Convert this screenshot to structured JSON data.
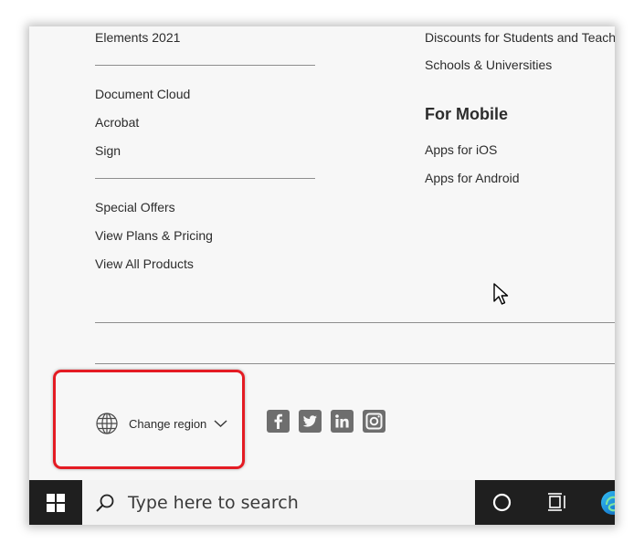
{
  "footer": {
    "left_column": {
      "group_1": [
        "Elements 2021"
      ],
      "group_2": [
        "Document Cloud",
        "Acrobat",
        "Sign"
      ],
      "group_3": [
        "Special Offers",
        "View Plans & Pricing",
        "View All Products"
      ]
    },
    "right_column": {
      "links_top": [
        "Discounts for Students and Teachers",
        "Schools & Universities"
      ],
      "mobile_heading": "For Mobile",
      "mobile_links": [
        "Apps for iOS",
        "Apps for Android"
      ]
    },
    "region_label": "Change region",
    "social_icons": [
      "facebook-icon",
      "twitter-icon",
      "linkedin-icon",
      "instagram-icon"
    ]
  },
  "taskbar": {
    "search_placeholder": "Type here to search"
  },
  "colors": {
    "page_background": "#f7f7f7",
    "text": "#2c2c2c",
    "highlight": "#e41b23",
    "taskbar": "#1f1f1f",
    "social_icon": "#6e6e6e"
  }
}
